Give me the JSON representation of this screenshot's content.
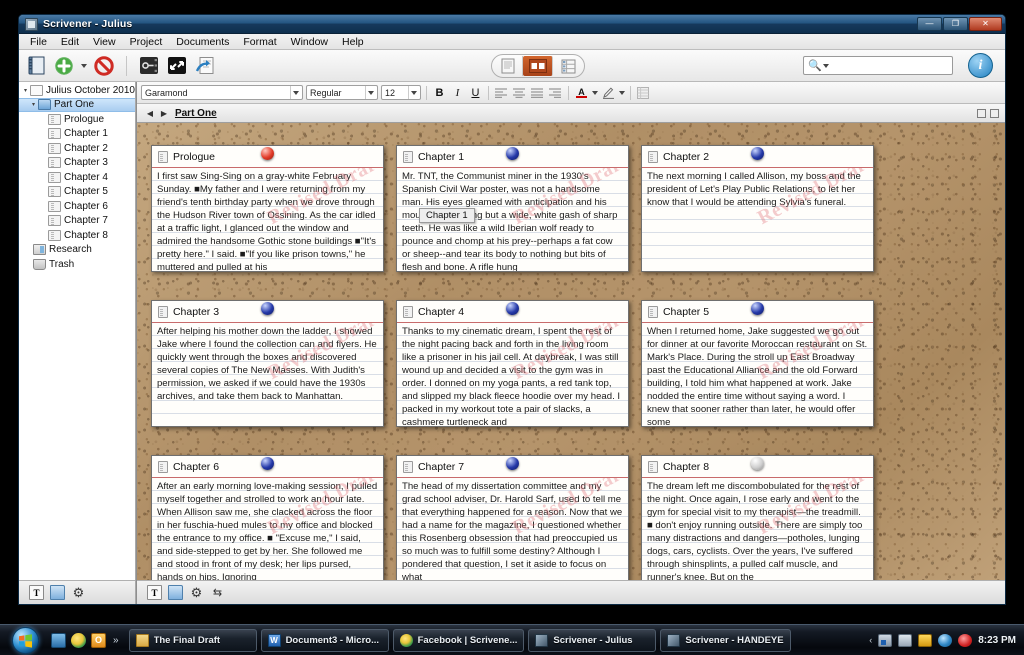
{
  "window": {
    "title": "Scrivener - Julius",
    "icon": "scrivener-icon",
    "controls": {
      "minimize": "—",
      "maximize": "❐",
      "close": "✕"
    }
  },
  "menubar": {
    "items": [
      "File",
      "Edit",
      "View",
      "Project",
      "Documents",
      "Format",
      "Window",
      "Help"
    ]
  },
  "toolbar": {
    "buttons": [
      {
        "name": "binder-toggle-icon",
        "glyph": "notebook"
      },
      {
        "name": "add-icon",
        "glyph": "plus"
      },
      {
        "name": "add-dropdown-caret-icon",
        "glyph": "caret"
      },
      {
        "name": "delete-icon",
        "glyph": "no-entry"
      },
      {
        "name": "inspector-icon",
        "glyph": "keycard"
      },
      {
        "name": "full-screen-icon",
        "glyph": "arrows"
      },
      {
        "name": "import-icon",
        "glyph": "import"
      }
    ],
    "view_modes": [
      {
        "name": "view-mode-document",
        "selected": false
      },
      {
        "name": "view-mode-corkboard",
        "selected": true
      },
      {
        "name": "view-mode-outliner",
        "selected": false
      }
    ],
    "search": {
      "placeholder": "",
      "value": "",
      "icon": "search-icon"
    },
    "info_button": {
      "label": "i",
      "name": "inspector-info-button"
    }
  },
  "format_bar": {
    "font": "Garamond",
    "style": "Regular",
    "size": "12",
    "bold": "B",
    "italic": "I",
    "underline": "U",
    "align": [
      "align-left",
      "align-center",
      "align-right",
      "align-justify"
    ],
    "text_color": "A",
    "highlight": "✎",
    "list": "list-icon"
  },
  "sidebar": {
    "items": [
      {
        "label": "Julius October 2010",
        "icon": "project-icon",
        "depth": 0,
        "twisty": "▾",
        "selected": false
      },
      {
        "label": "Part One",
        "icon": "folder-icon",
        "depth": 1,
        "twisty": "▾",
        "selected": true
      },
      {
        "label": "Prologue",
        "icon": "document-icon",
        "depth": 2,
        "twisty": "",
        "selected": false
      },
      {
        "label": "Chapter 1",
        "icon": "document-icon",
        "depth": 2,
        "twisty": "",
        "selected": false
      },
      {
        "label": "Chapter 2",
        "icon": "document-icon",
        "depth": 2,
        "twisty": "",
        "selected": false
      },
      {
        "label": "Chapter 3",
        "icon": "document-icon",
        "depth": 2,
        "twisty": "",
        "selected": false
      },
      {
        "label": "Chapter 4",
        "icon": "document-icon",
        "depth": 2,
        "twisty": "",
        "selected": false
      },
      {
        "label": "Chapter 5",
        "icon": "document-icon",
        "depth": 2,
        "twisty": "",
        "selected": false
      },
      {
        "label": "Chapter 6",
        "icon": "document-icon",
        "depth": 2,
        "twisty": "",
        "selected": false
      },
      {
        "label": "Chapter 7",
        "icon": "document-icon",
        "depth": 2,
        "twisty": "",
        "selected": false
      },
      {
        "label": "Chapter 8",
        "icon": "document-icon",
        "depth": 2,
        "twisty": "",
        "selected": false
      },
      {
        "label": "Research",
        "icon": "research-icon",
        "depth": 1,
        "twisty": "",
        "selected": false
      },
      {
        "label": "Trash",
        "icon": "trash-icon",
        "depth": 1,
        "twisty": "",
        "selected": false
      }
    ],
    "footer_icons": [
      "add-text-icon",
      "add-folder-icon",
      "settings-gear-icon"
    ]
  },
  "header_bar": {
    "back": "◀",
    "forward": "▶",
    "breadcrumb": "Part One",
    "right_icons": [
      "split-horizontal-icon",
      "split-vertical-icon"
    ]
  },
  "corkboard": {
    "watermark": "Revised Draft",
    "tooltip": {
      "text": "Chapter 1",
      "visible": true
    },
    "cards": [
      {
        "title": "Prologue",
        "pin": "red",
        "text": "I first saw Sing-Sing on a gray-white February Sunday. ■My father and I were returning from my friend's tenth birthday party when we drove through the Hudson River town of Ossining. As the car idled at a traffic light, I glanced out the window and admired the handsome Gothic stone buildings ■\"It's pretty here.\" I said. ■\"If you like prison towns,\" he muttered and pulled at his"
      },
      {
        "title": "Chapter 1",
        "pin": "blue",
        "text": "Mr. TNT, the Communist miner in the 1930's Spanish Civil War poster, was not a handsome man. His eyes gleamed with anticipation and his mouth was nothing but a wide, white gash of sharp teeth. He was like a wild Iberian wolf ready to pounce and chomp at his prey--perhaps a fat cow or sheep--and tear its body to nothing but bits of flesh and bone.  A rifle hung"
      },
      {
        "title": "Chapter 2",
        "pin": "blue",
        "text": " The next morning I called Allison, my boss and the president of Let's Play Public Relations, to let her know that I would be attending Sylvia's funeral."
      },
      {
        "title": "Chapter 3",
        "pin": "blue",
        "text": "After helping his mother down the ladder, I showed Jake where I found the collection can and flyers. He quickly went through the boxes and discovered several copies of The New Masses. With Judith's permission, we asked if we could have the 1930s archives, and take them back to Manhattan."
      },
      {
        "title": "Chapter 4",
        "pin": "blue",
        "text": "Thanks to my cinematic dream, I spent the rest of the night pacing back and forth in the living room like a prisoner in his jail cell. At daybreak, I was still wound up and decided a visit to the gym was in order. I donned on my yoga pants, a red tank top, and slipped my black fleece hoodie over my head. I packed in my workout tote a pair of slacks, a cashmere turtleneck and"
      },
      {
        "title": "Chapter 5",
        "pin": "blue",
        "text": "When I returned home, Jake suggested we go out for dinner at our favorite Moroccan restaurant on St. Mark's Place.  During the stroll up East Broadway past the Educational Alliance and the old Forward building, I told him what happened at work. Jake nodded the entire time without saying a word. I knew that sooner rather than later, he would offer some"
      },
      {
        "title": "Chapter 6",
        "pin": "blue",
        "text": "   After an early morning love-making session, I pulled myself together and strolled to work an hour late. When Allison saw me, she clacked across the floor in her fuschia-hued mules to my office and blocked the entrance to my office. ■ \"Excuse me,\" I said, and side-stepped to get by her. She followed me and stood in front of my desk; her lips pursed, hands on hips. Ignoring"
      },
      {
        "title": "Chapter 7",
        "pin": "blue",
        "text": "The head of my dissertation committee and my grad school adviser, Dr. Harold Sarf, used to tell me that everything happened for a reason. Now that we had a name for the magazine, I questioned whether this Rosenberg obsession that had preoccupied us so much was to fulfill some destiny? Although I pondered that question, I set it aside to focus on what"
      },
      {
        "title": "Chapter 8",
        "pin": "gray",
        "text": "The dream left me discombobulated for the rest of the night. Once again, I rose early and went to the gym for special visit to my therapist—the treadmill. ■ don't enjoy running outside. There are simply too many distractions and dangers—potholes, lunging dogs, cars, cyclists. Over the years, I've suffered through shinsplints, a pulled calf muscle, and runner's knee. But on the"
      }
    ],
    "footer_icons": [
      "add-text-icon",
      "add-folder-icon",
      "settings-gear-icon",
      "swap-icon"
    ]
  },
  "taskbar": {
    "start": "start-orb-icon",
    "quick_launch": [
      "show-desktop-icon",
      "chrome-icon",
      "orange-app-icon"
    ],
    "overflow": "»",
    "tasks": [
      {
        "label": "The Final Draft",
        "icon": "folder"
      },
      {
        "label": "Document3 - Micro...",
        "icon": "word"
      },
      {
        "label": "Facebook | Scrivene...",
        "icon": "chrome"
      },
      {
        "label": "Scrivener - Julius",
        "icon": "scriv"
      },
      {
        "label": "Scrivener - HANDEYE",
        "icon": "scriv"
      }
    ],
    "tray": {
      "chevron": "‹",
      "icons": [
        "network-icon",
        "monitor-icon",
        "shield-icon",
        "globe-icon",
        "volume-icon"
      ],
      "clock": "8:23 PM"
    }
  }
}
